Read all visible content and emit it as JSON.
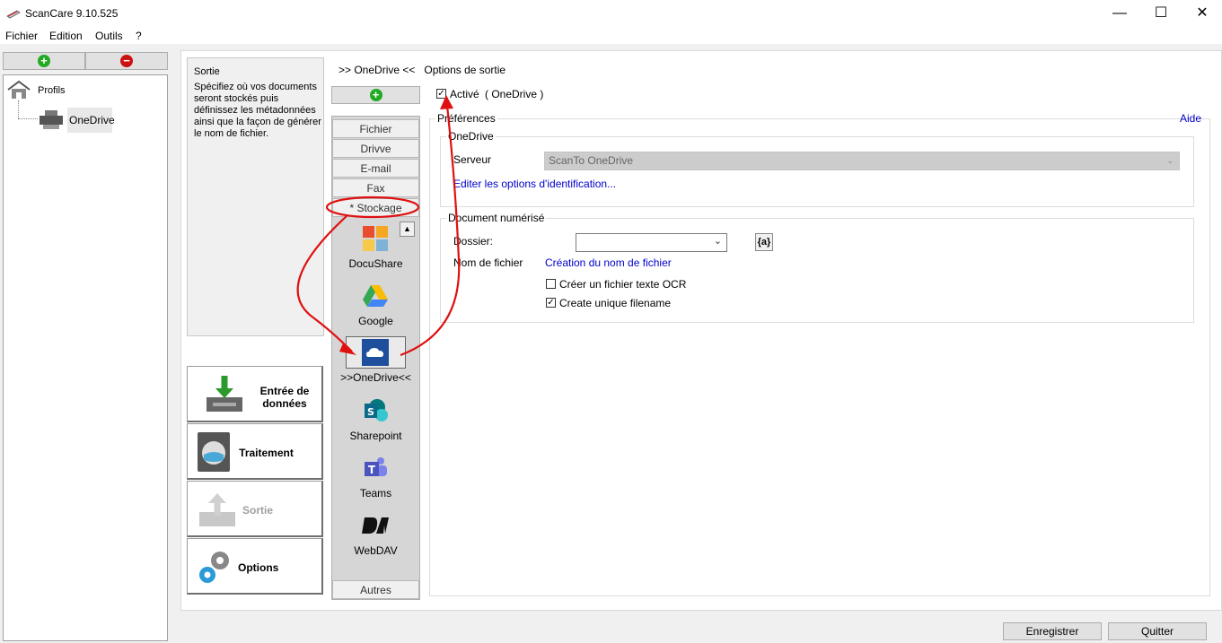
{
  "window": {
    "title": "ScanCare 9.10.525"
  },
  "menu": [
    "Fichier",
    "Edition",
    "Outils",
    "?"
  ],
  "tree": {
    "root": "Profils",
    "child": "OneDrive"
  },
  "description": {
    "title": "Sortie",
    "text": "Spécifiez où vos documents seront stockés puis définissez les métadonnées ainsi que la façon de générer le nom de fichier."
  },
  "nav_buttons": {
    "entree": "Entrée de données",
    "traitement": "Traitement",
    "sortie": "Sortie",
    "options": "Options"
  },
  "output_tabs": [
    "Fichier",
    "Drivve",
    "E-mail",
    "Fax",
    "* Stockage"
  ],
  "services": [
    "DocuShare",
    "Google",
    ">>OneDrive<<",
    "Sharepoint",
    "Teams",
    "WebDAV"
  ],
  "others_tab": "Autres",
  "breadcrumb": ">> OneDrive <<   Options de sortie",
  "active": {
    "label": "Activé",
    "service": "( OneDrive )"
  },
  "preferences": {
    "legend": "Préférences",
    "help": "Aide"
  },
  "onedrive_group": {
    "legend": "OneDrive",
    "server_label": "Serveur",
    "server_value": "ScanTo OneDrive",
    "edit_link": "Editer les options d'identification..."
  },
  "document_group": {
    "legend": "Document numérisé",
    "folder_label": "Dossier:",
    "filename_label": "Nom de fichier",
    "filename_link": "Création du nom de fichier",
    "macro_btn": "{a}",
    "ocr_label": "Créer un fichier texte OCR",
    "unique_label": "Create unique filename"
  },
  "bottom": {
    "save": "Enregistrer",
    "quit": "Quitter"
  },
  "colors": {
    "accent_red": "#e01010",
    "link_blue": "#0000cc",
    "add_green": "#22aa22",
    "remove_red": "#cc1111",
    "onedrive_blue": "#1d4f9c"
  }
}
